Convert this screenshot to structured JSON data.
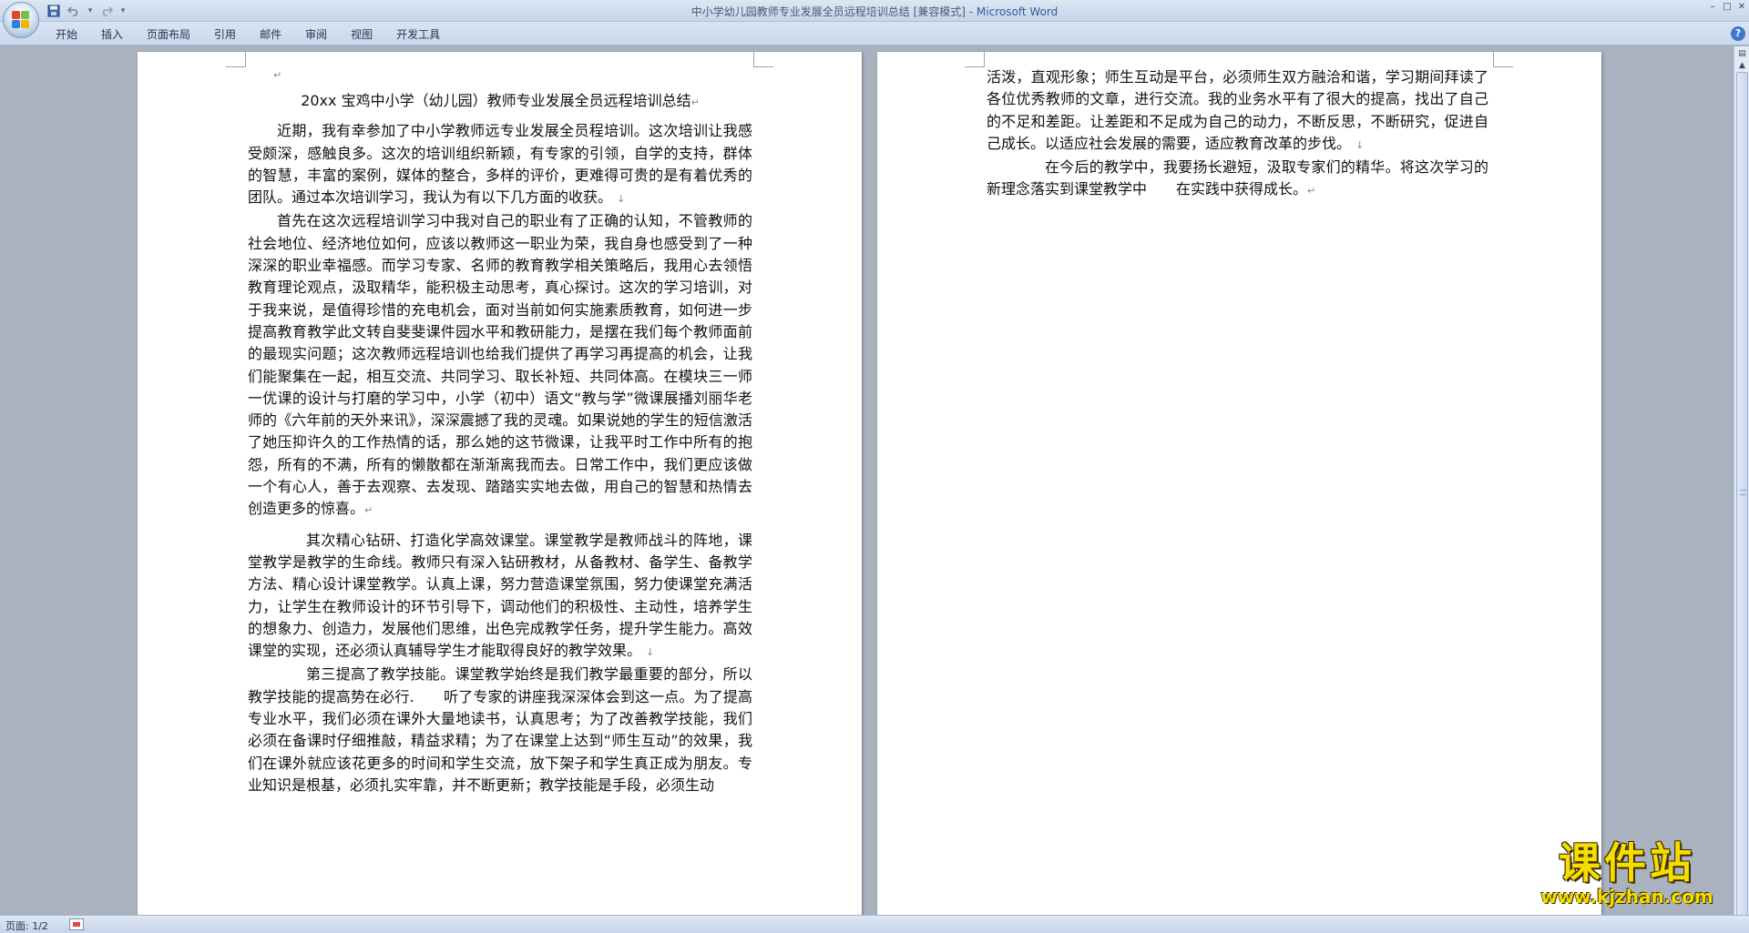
{
  "window": {
    "title_doc": "中小学幼儿园教师专业发展全员远程培训总结 [兼容模式] - ",
    "title_app": "Microsoft Word",
    "minimize": "–",
    "maximize": "□",
    "close": "✕"
  },
  "quick_access": {
    "save_icon": "save-icon",
    "undo_icon": "undo-icon",
    "redo_icon": "redo-icon",
    "customize_icon": "dropdown-arrow-icon"
  },
  "ribbon": {
    "tabs": [
      "开始",
      "插入",
      "页面布局",
      "引用",
      "邮件",
      "审阅",
      "视图",
      "开发工具"
    ],
    "help": "?"
  },
  "document": {
    "left_page": {
      "title": "20xx 宝鸡中小学（幼儿园）教师专业发展全员远程培训总结",
      "paragraphs": [
        "近期，我有幸参加了中小学教师远专业发展全员程培训。这次培训让我感受颇深，感触良多。这次的培训组织新颖，有专家的引领，自学的支持，群体的智慧，丰富的案例，媒体的整合，多样的评价，更难得可贵的是有着优秀的团队。通过本次培训学习，我认为有以下几方面的收获。",
        "首先在这次远程培训学习中我对自己的职业有了正确的认知，不管教师的社会地位、经济地位如何，应该以教师这一职业为荣，我自身也感受到了一种深深的职业幸福感。而学习专家、名师的教育教学相关策略后，我用心去领悟教育理论观点，汲取精华，能积极主动思考，真心探讨。这次的学习培训，对于我来说，是值得珍惜的充电机会，面对当前如何实施素质教育，如何进一步提高教育教学此文转自斐斐课件园水平和教研能力，是摆在我们每个教师面前的最现实问题；这次教师远程培训也给我们提供了再学习再提高的机会，让我们能聚集在一起，相互交流、共同学习、取长补短、共同体高。在模块三一师一优课的设计与打磨的学习中，小学（初中）语文“教与学”微课展播刘丽华老师的《六年前的天外来讯》，深深震撼了我的灵魂。如果说她的学生的短信激活了她压抑许久的工作热情的话，那么她的这节微课，让我平时工作中所有的抱怨，所有的不满，所有的懒散都在渐渐离我而去。日常工作中，我们更应该做一个有心人，善于去观察、去发现、踏踏实实地去做，用自己的智慧和热情去创造更多的惊喜。",
        "其次精心钻研、打造化学高效课堂。课堂教学是教师战斗的阵地，课堂教学是教学的生命线。教师只有深入钻研教材，从备教材、备学生、备教学方法、精心设计课堂教学。认真上课，努力营造课堂氛围，努力使课堂充满活力，让学生在教师设计的环节引导下，调动他们的积极性、主动性，培养学生的想象力、创造力，发展他们思维，出色完成教学任务，提升学生能力。高效课堂的实现，还必须认真辅导学生才能取得良好的教学效果。",
        "第三提高了教学技能。课堂教学始终是我们教学最重要的部分，所以教学技能的提高势在必行.　　听了专家的讲座我深深体会到这一点。为了提高专业水平，我们必须在课外大量地读书，认真思考；为了改善教学技能，我们必须在备课时仔细推敲，精益求精；为了在课堂上达到“师生互动”的效果，我们在课外就应该花更多的时间和学生交流，放下架子和学生真正成为朋友。专业知识是根基，必须扎实牢靠，并不断更新；教学技能是手段，必须生动"
      ]
    },
    "right_page": {
      "paragraphs": [
        "活泼，直观形象；师生互动是平台，必须师生双方融洽和谐，学习期间拜读了各位优秀教师的文章，进行交流。我的业务水平有了很大的提高，找出了自己的不足和差距。让差距和不足成为自己的动力，不断反思，不断研究，促进自己成长。以适应社会发展的需要，适应教育改革的步伐。",
        "在今后的教学中，我要扬长避短，汲取专家们的精华。将这次学习的新理念落实到课堂教学中　　在实践中获得成长。"
      ]
    },
    "para_mark": "↵",
    "line_mark": "↓"
  },
  "status": {
    "page": "页面: 1/2"
  },
  "watermark": {
    "main": "课件站",
    "url": "www.kjzhan.com"
  },
  "colors": {
    "title_app": "#2f5d9c",
    "workspace": "#a9b2be",
    "watermark": "#f6dd00"
  }
}
